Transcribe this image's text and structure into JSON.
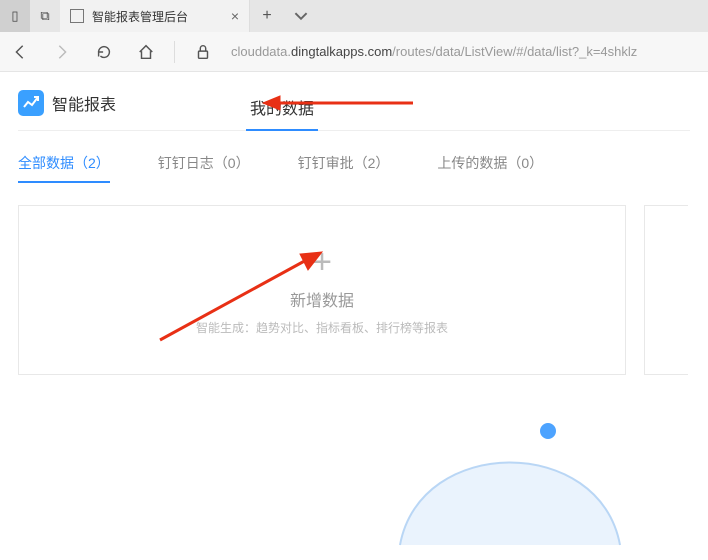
{
  "browser": {
    "tab_title": "智能报表管理后台",
    "url_prefix": "clouddata.",
    "url_host": "dingtalkapps.com",
    "url_path": "/routes/data/ListView/#/data/list?_k=4shklz"
  },
  "brand": {
    "name": "智能报表"
  },
  "nav": {
    "active": "我的数据"
  },
  "subtabs": {
    "items": [
      {
        "label": "全部数据（2）",
        "active": true
      },
      {
        "label": "钉钉日志（0）"
      },
      {
        "label": "钉钉审批（2）"
      },
      {
        "label": "上传的数据（0）"
      }
    ]
  },
  "add_card": {
    "plus": "+",
    "title": "新增数据",
    "subtitle": "智能生成：趋势对比、指标看板、排行榜等报表"
  }
}
